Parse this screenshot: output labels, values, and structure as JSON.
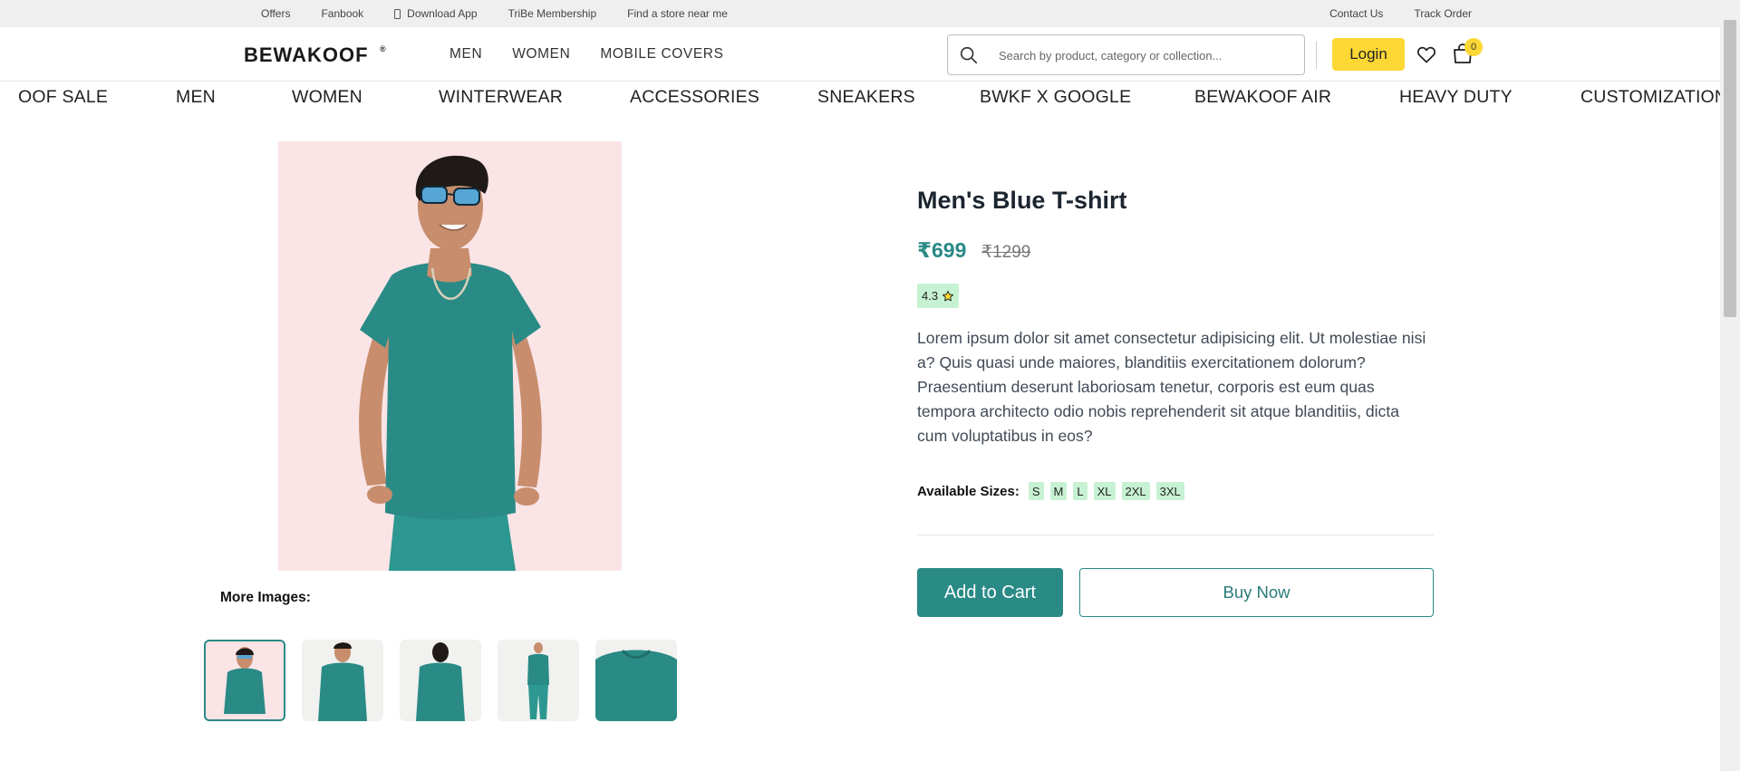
{
  "topbar": {
    "left_links": [
      "Offers",
      "Fanbook",
      "Download App",
      "TriBe Membership",
      "Find a store near me"
    ],
    "right_links": [
      "Contact Us",
      "Track Order"
    ]
  },
  "header": {
    "logo": "Bewakoof",
    "logo_mark": "®",
    "nav": [
      "MEN",
      "WOMEN",
      "MOBILE COVERS"
    ],
    "search_placeholder": "Search by product, category or collection...",
    "login_label": "Login",
    "cart_count": "0",
    "icons": [
      "search-icon",
      "heart-icon",
      "bag-icon"
    ]
  },
  "categories": [
    "OOF SALE",
    "MEN",
    "WOMEN",
    "WINTERWEAR",
    "ACCESSORIES",
    "SNEAKERS",
    "BWKF X GOOGLE",
    "BEWAKOOF AIR",
    "HEAVY DUTY",
    "CUSTOMIZATION"
  ],
  "product": {
    "title": "Men's Blue T-shirt",
    "price": "₹699",
    "mrp": "₹1299",
    "rating": "4.3",
    "description": "Lorem ipsum dolor sit amet consectetur adipisicing elit. Ut molestiae nisi a? Quis quasi unde maiores, blanditiis exercitationem dolorum? Praesentium deserunt laboriosam tenetur, corporis est eum quas tempora architecto odio nobis reprehenderit sit atque blanditiis, dicta cum voluptatibus in eos?",
    "sizes_label": "Available Sizes:",
    "sizes": [
      "S",
      "M",
      "L",
      "XL",
      "2XL",
      "3XL"
    ],
    "more_images_label": "More Images:",
    "add_to_cart": "Add to Cart",
    "buy_now": "Buy Now"
  },
  "colors": {
    "accent": "#2a8a86",
    "login_bg": "#fdd835",
    "badge_bg": "#c6f2d3",
    "image_bg": "#fae4e6"
  }
}
